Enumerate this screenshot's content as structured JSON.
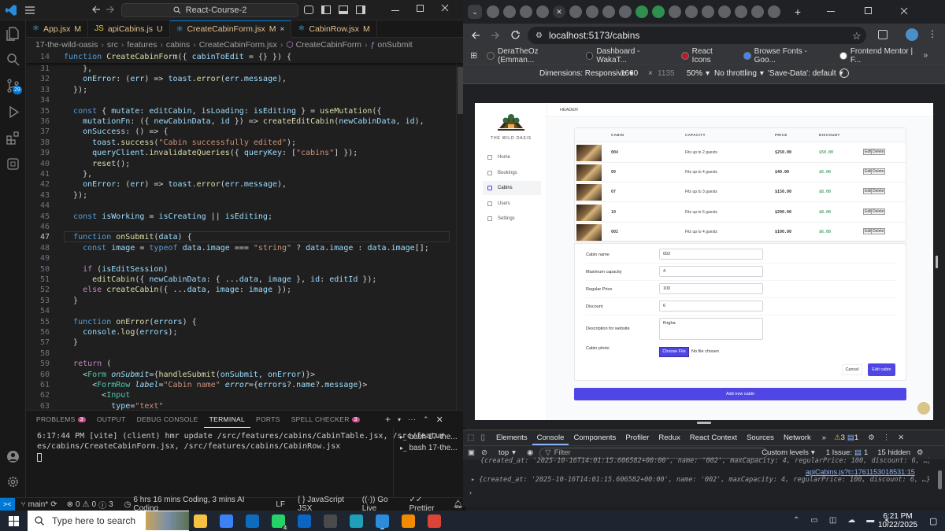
{
  "vscode": {
    "search_text": "React-Course-2",
    "tabs": [
      {
        "label": "App.jsx",
        "status": "M",
        "active": false
      },
      {
        "label": "apiCabins.js",
        "status": "U",
        "active": false
      },
      {
        "label": "CreateCabinForm.jsx",
        "status": "M",
        "active": true
      },
      {
        "label": "CabinRow.jsx",
        "status": "M",
        "active": false
      }
    ],
    "breadcrumb": [
      "17-the-wild-oasis",
      "src",
      "features",
      "cabins",
      "CreateCabinForm.jsx",
      "CreateCabinForm",
      "onSubmit"
    ],
    "sticky_line": {
      "num": "14",
      "text": "function CreateCabinForm({ cabinToEdit = {} }) {"
    },
    "code_lines": [
      {
        "num": "31",
        "text": "    },"
      },
      {
        "num": "32",
        "text": "    onError: (err) => toast.error(err.message),"
      },
      {
        "num": "33",
        "text": "  });"
      },
      {
        "num": "34",
        "text": ""
      },
      {
        "num": "35",
        "text": "  const { mutate: editCabin, isLoading: isEditing } = useMutation({"
      },
      {
        "num": "36",
        "text": "    mutationFn: ({ newCabinData, id }) => createEditCabin(newCabinData, id),"
      },
      {
        "num": "37",
        "text": "    onSuccess: () => {"
      },
      {
        "num": "38",
        "text": "      toast.success(\"Cabin successfully edited\");"
      },
      {
        "num": "39",
        "text": "      queryClient.invalidateQueries({ queryKey: [\"cabins\"] });"
      },
      {
        "num": "40",
        "text": "      reset();"
      },
      {
        "num": "41",
        "text": "    },"
      },
      {
        "num": "42",
        "text": "    onError: (err) => toast.error(err.message),"
      },
      {
        "num": "43",
        "text": "  });"
      },
      {
        "num": "44",
        "text": ""
      },
      {
        "num": "45",
        "text": "  const isWorking = isCreating || isEditing;"
      },
      {
        "num": "46",
        "text": ""
      },
      {
        "num": "47",
        "text": "  function onSubmit(data) {"
      },
      {
        "num": "48",
        "text": "    const image = typeof data.image === \"string\" ? data.image : data.image[0];"
      },
      {
        "num": "49",
        "text": ""
      },
      {
        "num": "50",
        "text": "    if (isEditSession)"
      },
      {
        "num": "51",
        "text": "      editCabin({ newCabinData: { ...data, image }, id: editId });"
      },
      {
        "num": "52",
        "text": "    else createCabin({ ...data, image: image });"
      },
      {
        "num": "53",
        "text": "  }"
      },
      {
        "num": "54",
        "text": ""
      },
      {
        "num": "55",
        "text": "  function onError(errors) {"
      },
      {
        "num": "56",
        "text": "    console.log(errors);"
      },
      {
        "num": "57",
        "text": "  }"
      },
      {
        "num": "58",
        "text": ""
      },
      {
        "num": "59",
        "text": "  return ("
      },
      {
        "num": "60",
        "text": "    <Form onSubmit={handleSubmit(onSubmit, onError)}>"
      },
      {
        "num": "61",
        "text": "      <FormRow label=\"Cabin name\" error={errors?.name?.message}>"
      },
      {
        "num": "62",
        "text": "        <Input"
      },
      {
        "num": "63",
        "text": "          type=\"text\""
      }
    ],
    "panel_tabs": [
      {
        "label": "PROBLEMS",
        "badge": "3"
      },
      {
        "label": "OUTPUT",
        "badge": ""
      },
      {
        "label": "DEBUG CONSOLE",
        "badge": ""
      },
      {
        "label": "TERMINAL",
        "badge": ""
      },
      {
        "label": "PORTS",
        "badge": ""
      },
      {
        "label": "SPELL CHECKER",
        "badge": "3"
      }
    ],
    "terminal_lines": [
      "6:17:44 PM [vite] (client) hmr update /src/features/cabins/CabinTable.jsx, /src/featur",
      "es/cabins/CreateCabinForm.jsx, /src/features/cabins/CabinRow.jsx"
    ],
    "terminal_sessions": [
      "bash 17-the...",
      "bash 17-the..."
    ],
    "status": {
      "branch": "main*",
      "errors": "0",
      "warnings": "0",
      "info": "3",
      "coding_time": "6 hrs 16 mins Coding, 3 mins AI Coding",
      "eol": "LF",
      "language": "JavaScript JSX",
      "golive": "Go Live",
      "prettier": "Prettier"
    },
    "scm_badge": "29"
  },
  "chrome": {
    "url": "localhost:5173/cabins",
    "bookmarks": [
      "DeraTheOz (Emman...",
      "Dashboard - WakaT...",
      "React Icons",
      "Browse Fonts - Goo...",
      "Frontend Mentor | F..."
    ],
    "devbar": {
      "dimensions": "Dimensions: Responsive",
      "width": "1660",
      "height": "1135",
      "zoom": "50%",
      "throttle": "No throttling",
      "save_data": "'Save-Data': default"
    },
    "app": {
      "brand": "THE WILD OASIS",
      "header": "HEADER",
      "nav": [
        {
          "label": "Home",
          "active": false
        },
        {
          "label": "Bookings",
          "active": false
        },
        {
          "label": "Cabins",
          "active": true
        },
        {
          "label": "Users",
          "active": false
        },
        {
          "label": "Settings",
          "active": false
        }
      ],
      "table_headers": [
        "",
        "CABIN",
        "CAPACITY",
        "PRICE",
        "DISCOUNT",
        ""
      ],
      "cabins": [
        {
          "name": "004",
          "capacity": "Fits up to 2 guests",
          "price": "$250.00",
          "discount": "$50.00"
        },
        {
          "name": "09",
          "capacity": "Fits up to 4 guests",
          "price": "$40.00",
          "discount": "$6.00"
        },
        {
          "name": "07",
          "capacity": "Fits up to 3 guests",
          "price": "$150.00",
          "discount": "$8.00"
        },
        {
          "name": "10",
          "capacity": "Fits up to 6 guests",
          "price": "$200.00",
          "discount": "$8.00"
        },
        {
          "name": "002",
          "capacity": "Fits up to 4 guests",
          "price": "$100.00",
          "discount": "$6.00"
        }
      ],
      "row_actions": [
        "Edit",
        "Delete"
      ],
      "form": {
        "fields": [
          {
            "label": "Cabin name",
            "value": "002"
          },
          {
            "label": "Maximum capacity",
            "value": "4"
          },
          {
            "label": "Regular Price",
            "value": "100"
          },
          {
            "label": "Discount",
            "value": "6"
          }
        ],
        "description_label": "Description for website",
        "description_value": "fhrgha",
        "photo_label": "Cabin photo",
        "choose_file": "Choose File",
        "no_file": "No file chosen",
        "cancel": "Cancel",
        "submit": "Edit cabin"
      },
      "add_button": "Add new cabin"
    },
    "devtools": {
      "tabs": [
        "Elements",
        "Console",
        "Components",
        "Profiler",
        "Redux",
        "React Context",
        "Sources",
        "Network"
      ],
      "warnings": "3",
      "messages": "1",
      "context": "top",
      "filter_placeholder": "Filter",
      "levels": "Custom levels",
      "issues": "1 Issue:",
      "issue_count": "1",
      "hidden": "15 hidden",
      "log_partial": "{created_at: '2025-10-16T14:01:15.606582+00:00', name: '002', maxCapacity: 4, regularPrice: 100, discount: 6, …}",
      "log_source": "apiCabins.js?t=1761153018531:15",
      "log_line": "{created_at: '2025-10-16T14:01:15.606582+00:00', name: '002', maxCapacity: 4, regularPrice: 100, discount: 6, …}",
      "log_count": "7"
    }
  },
  "taskbar": {
    "search": "Type here to search",
    "time": "6:21 PM",
    "date": "10/22/2025",
    "whatsapp_badge": "4"
  },
  "colors": {
    "accent": "#0078d4",
    "brand": "#4f46e5",
    "status_bg": "#181818"
  }
}
